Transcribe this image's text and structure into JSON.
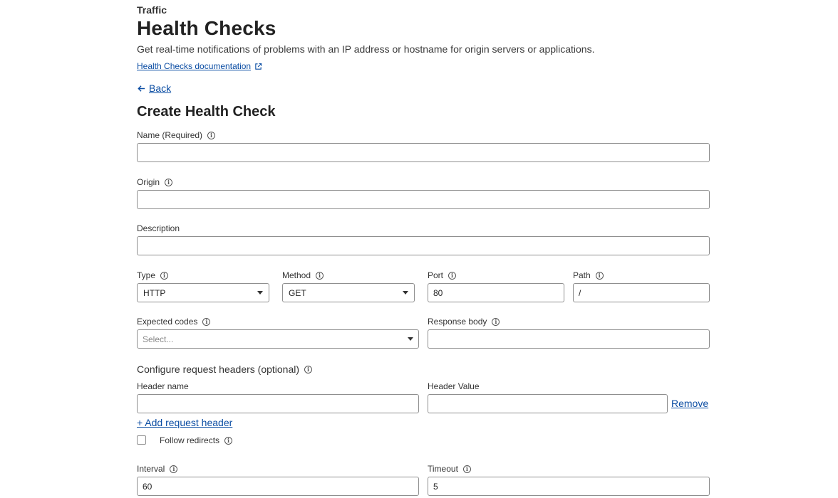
{
  "header": {
    "eyebrow": "Traffic",
    "title": "Health Checks",
    "subtitle": "Get real-time notifications of problems with an IP address or hostname for origin servers or applications.",
    "doc_link": "Health Checks documentation",
    "back": "Back"
  },
  "form": {
    "title": "Create Health Check",
    "name": {
      "label": "Name (Required)",
      "value": ""
    },
    "origin": {
      "label": "Origin",
      "value": ""
    },
    "description": {
      "label": "Description",
      "value": ""
    },
    "type": {
      "label": "Type",
      "value": "HTTP"
    },
    "method": {
      "label": "Method",
      "value": "GET"
    },
    "port": {
      "label": "Port",
      "value": "80"
    },
    "path": {
      "label": "Path",
      "value": "/"
    },
    "expected_codes": {
      "label": "Expected codes",
      "placeholder": "Select..."
    },
    "response_body": {
      "label": "Response body",
      "value": ""
    },
    "headers": {
      "title": "Configure request headers (optional)",
      "name_label": "Header name",
      "value_label": "Header Value",
      "name_value": "",
      "value_value": "",
      "remove": "Remove",
      "add": "+ Add request header"
    },
    "follow_redirects": {
      "label": "Follow redirects",
      "checked": false
    },
    "interval": {
      "label": "Interval",
      "value": "60"
    },
    "timeout": {
      "label": "Timeout",
      "value": "5"
    }
  },
  "icons": {
    "info": "info-icon",
    "external": "external-link-icon",
    "back": "arrow-left-icon",
    "dropdown": "chevron-down-icon"
  },
  "colors": {
    "link": "#0b4da3",
    "border": "#8f8f8f"
  }
}
